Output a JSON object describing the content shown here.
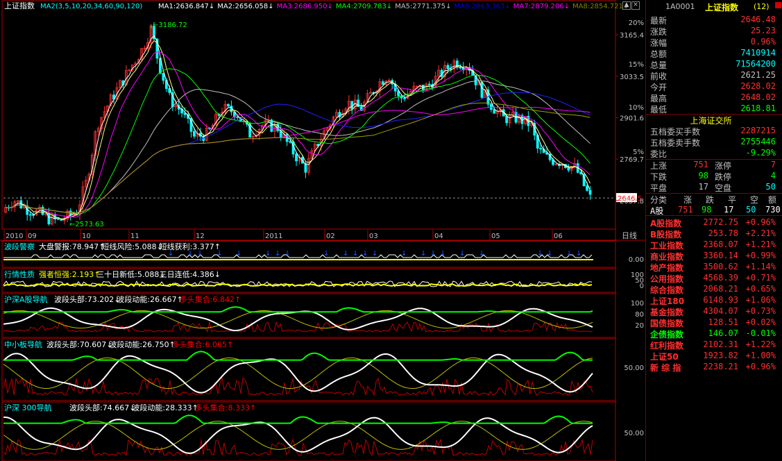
{
  "main": {
    "title": "上证指数",
    "ma_label": "MA2(3,5,10,20,34,60,90,120)",
    "mas": [
      {
        "label": "MA1:2636.847",
        "color": "#ffffff"
      },
      {
        "label": "MA2:2656.058",
        "color": "#ffffff"
      },
      {
        "label": "MA3:2686.950",
        "color": "#ff00ff"
      },
      {
        "label": "MA4:2709.783",
        "color": "#00ff00"
      },
      {
        "label": "MA5:2771.375",
        "color": "#c0c0c0"
      },
      {
        "label": "MA6:2863.363",
        "color": "#0000ff"
      },
      {
        "label": "MA7:2879.206",
        "color": "#ff00ff"
      },
      {
        "label": "MA8:2854.721",
        "color": "#808000"
      }
    ],
    "high_mark": "3186.72",
    "low_mark": "2573.63",
    "current_price_tag": "2646.5",
    "price_axis": [
      "3165.4",
      "3033.5",
      "2901.6",
      "2769.7",
      "2637.8"
    ],
    "pct_axis": [
      "20%",
      "15%",
      "10%",
      "5%"
    ],
    "time_axis": [
      "2010",
      "09",
      "10",
      "11",
      "12",
      "2011",
      "02",
      "03",
      "04",
      "05",
      "06"
    ],
    "period_label": "日线"
  },
  "panels": [
    {
      "id": "p1",
      "name": "波段警察",
      "items": [
        {
          "label": "大盘警报:78.947↑",
          "color": "#ffffff"
        },
        {
          "label": "短线风险:5.088↓",
          "color": "#ffffff"
        },
        {
          "label": "短线获利:3.377↑",
          "color": "#ffffff"
        }
      ],
      "axis": [
        "0.00"
      ]
    },
    {
      "id": "p2",
      "name": "行情性质",
      "items": [
        {
          "label": "强者恒强:2.193↑",
          "color": "#ffff00"
        },
        {
          "label": "三十日新低:5.088↓",
          "color": "#ffffff"
        },
        {
          "label": "三日连低:4.386↓",
          "color": "#ffffff"
        }
      ],
      "axis": [
        "100",
        "50",
        "0"
      ]
    },
    {
      "id": "p3",
      "name": "沪深A股导航",
      "items": [
        {
          "label": "波段头部:73.202↓",
          "color": "#ffffff"
        },
        {
          "label": "波段动能:26.667↑",
          "color": "#ffffff"
        },
        {
          "label": "多头集合:6.842↑",
          "color": "#ff0000"
        }
      ],
      "axis": [
        "100",
        "80",
        "20"
      ]
    },
    {
      "id": "p4",
      "name": "中小板导航",
      "items": [
        {
          "label": "波段头部:70.607↓",
          "color": "#ffffff"
        },
        {
          "label": "波段动能:26.750↑",
          "color": "#ffffff"
        },
        {
          "label": "多头集合:6.065↑",
          "color": "#ff0000"
        }
      ],
      "axis": [
        "50.00"
      ]
    },
    {
      "id": "p5",
      "name": "沪深 300导航",
      "items": [
        {
          "label": "波段头部:74.667↓",
          "color": "#ffffff"
        },
        {
          "label": "波段动能:28.333↑",
          "color": "#ffffff"
        },
        {
          "label": "多头集合:8.333↑",
          "color": "#ff0000"
        }
      ],
      "axis": [
        "50.00"
      ]
    }
  ],
  "quote": {
    "code": "1A0001",
    "name": "上证指数",
    "count": "(12)",
    "rows": [
      {
        "label": "最新",
        "value": "2646.48",
        "color": "#ff3030"
      },
      {
        "label": "涨跌",
        "value": "25.23",
        "color": "#ff3030"
      },
      {
        "label": "涨幅",
        "value": "0.96%",
        "color": "#ff3030"
      },
      {
        "label": "总额",
        "value": "7410914",
        "color": "#00ffff"
      },
      {
        "label": "总量",
        "value": "71564200",
        "color": "#00ffff"
      },
      {
        "label": "前收",
        "value": "2621.25",
        "color": "#c0c0c0"
      },
      {
        "label": "今开",
        "value": "2628.02",
        "color": "#ff3030"
      },
      {
        "label": "最高",
        "value": "2648.02",
        "color": "#ff3030"
      },
      {
        "label": "最低",
        "value": "2618.81",
        "color": "#00ff00"
      }
    ],
    "exchange": "上海证交所",
    "depth": [
      {
        "label": "五档委买手数",
        "value": "2287215",
        "color": "#ff3030"
      },
      {
        "label": "五档委卖手数",
        "value": "2755446",
        "color": "#00ff00"
      },
      {
        "label": "委比",
        "value": "-9.29%",
        "color": "#00ff00"
      }
    ],
    "breadth": [
      {
        "l1": "上涨",
        "v1": "751",
        "c1": "#ff3030",
        "l2": "涨停",
        "v2": "7",
        "c2": "#ff3030"
      },
      {
        "l1": "下跌",
        "v1": "98",
        "c1": "#00ff00",
        "l2": "跌停",
        "v2": "4",
        "c2": "#00ff00"
      },
      {
        "l1": "平盘",
        "v1": "17",
        "c1": "#c0c0c0",
        "l2": "空盘",
        "v2": "50",
        "c2": "#00ffff"
      }
    ],
    "class_header": [
      "分类",
      "涨",
      "跌",
      "平",
      "空",
      "额"
    ],
    "class_row": {
      "name": "A股",
      "up": "751",
      "down": "98",
      "flat": "17",
      "empty": "50",
      "amt": "730"
    },
    "indexes": [
      {
        "name": "A股指数",
        "price": "2772.75",
        "chg": "+0.96%"
      },
      {
        "name": "B股指数",
        "price": "253.78",
        "chg": "+2.21%"
      },
      {
        "name": "工业指数",
        "price": "2368.07",
        "chg": "+1.21%"
      },
      {
        "name": "商业指数",
        "price": "3360.14",
        "chg": "+0.99%"
      },
      {
        "name": "地产指数",
        "price": "3500.62",
        "chg": "+1.14%"
      },
      {
        "name": "公用指数",
        "price": "4568.39",
        "chg": "+0.71%"
      },
      {
        "name": "综合指数",
        "price": "2068.21",
        "chg": "+0.65%"
      },
      {
        "name": "上证180",
        "price": "6148.93",
        "chg": "+1.06%"
      },
      {
        "name": "基金指数",
        "price": "4304.07",
        "chg": "+0.73%"
      },
      {
        "name": "国债指数",
        "price": "128.51",
        "chg": "+0.02%"
      },
      {
        "name": "企债指数",
        "price": "146.07",
        "chg": "-0.01%"
      },
      {
        "name": "红利指数",
        "price": "2102.31",
        "chg": "+1.22%"
      },
      {
        "name": "上证50",
        "price": "1923.82",
        "chg": "+1.00%"
      },
      {
        "name": "新 综 指",
        "price": "2238.21",
        "chg": "+0.96%"
      }
    ]
  }
}
